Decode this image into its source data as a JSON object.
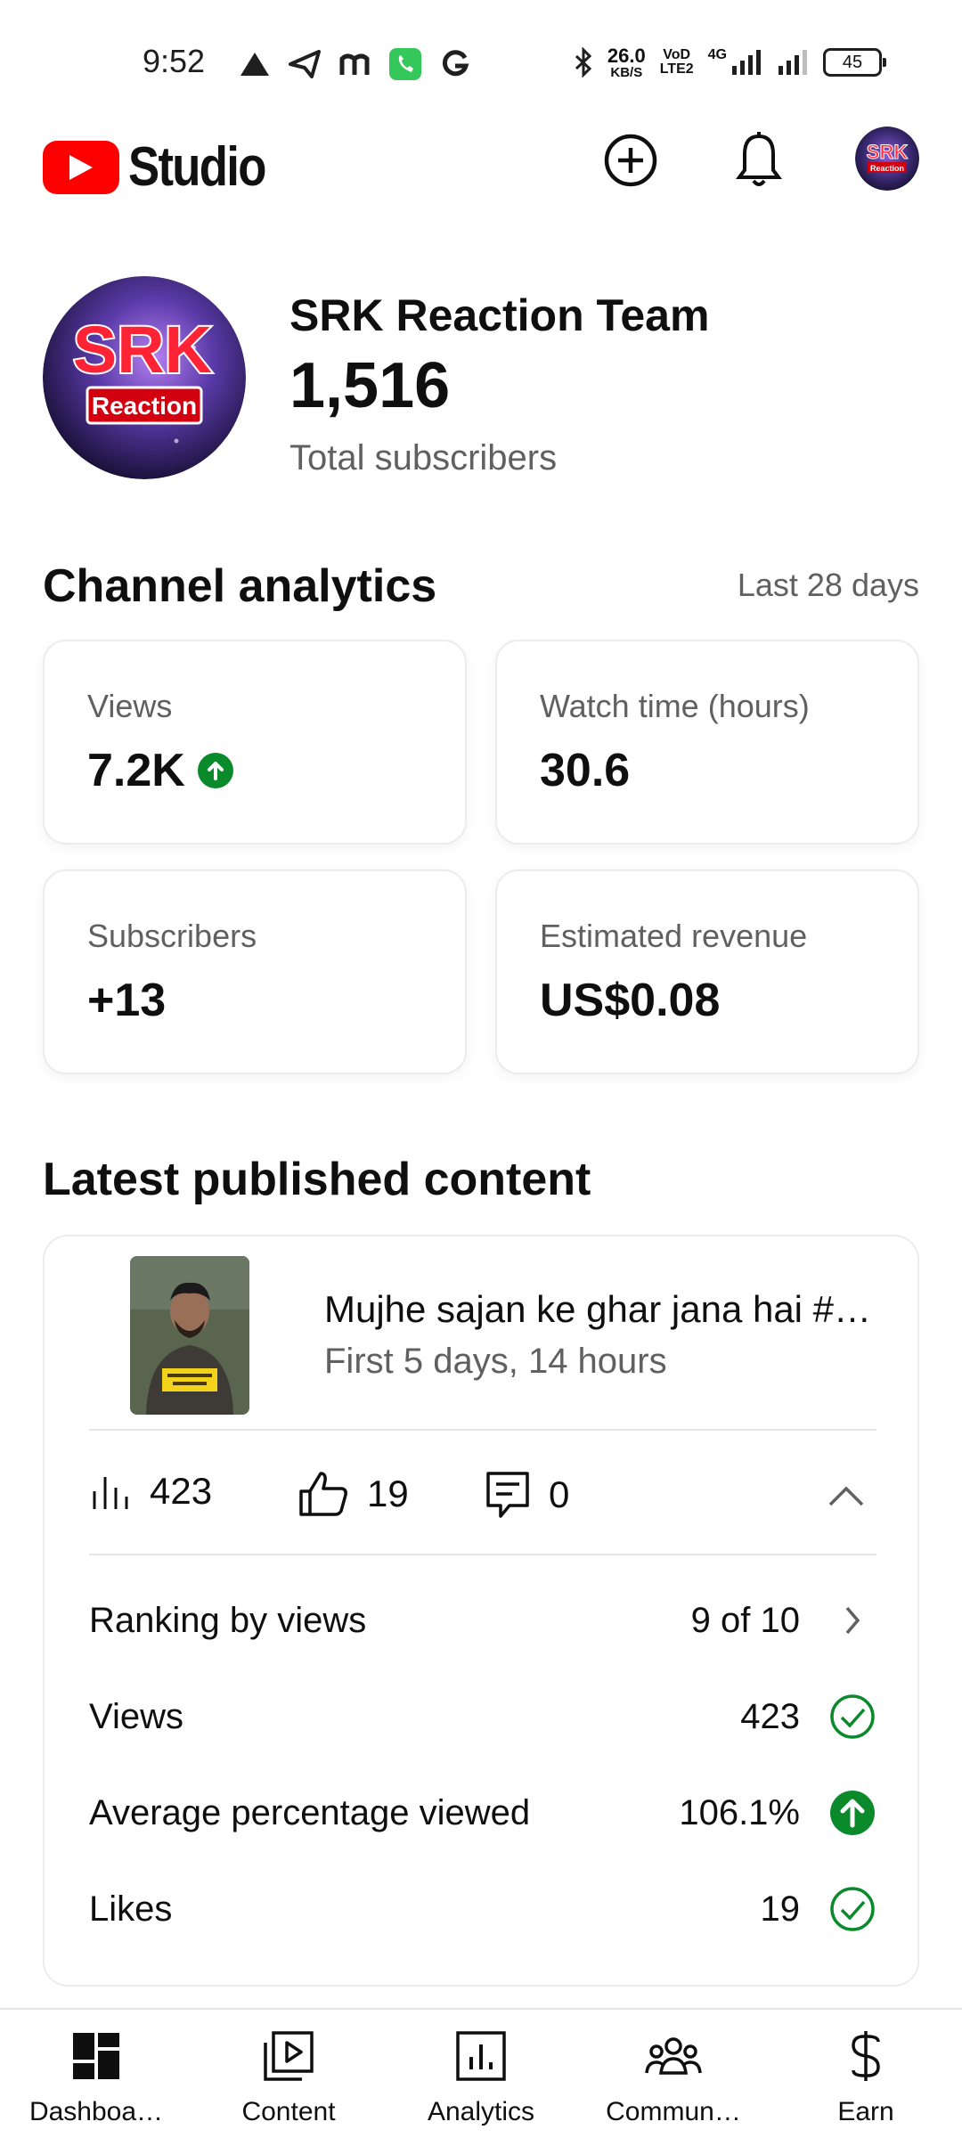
{
  "status_bar": {
    "time": "9:52",
    "left_icons": [
      "triangle-icon",
      "send-icon",
      "m-icon",
      "phone-icon",
      "g-icon"
    ],
    "net_speed_value": "26.0",
    "net_speed_unit": "KB/S",
    "volte_top": "VoD",
    "volte_bottom": "LTE2",
    "network": "4G",
    "battery": "45"
  },
  "app_bar": {
    "logo_text": "Studio",
    "create_icon": "plus-circle-icon",
    "notifications_icon": "bell-icon",
    "avatar_icon": "channel-avatar"
  },
  "channel": {
    "name": "SRK Reaction Team",
    "subscribers": "1,516",
    "subscribers_label": "Total subscribers",
    "avatar_top_text": "SRK",
    "avatar_bottom_text": "Reaction"
  },
  "analytics": {
    "title": "Channel analytics",
    "range": "Last 28 days",
    "cards": [
      {
        "label": "Views",
        "value": "7.2K",
        "trend": "up"
      },
      {
        "label": "Watch time (hours)",
        "value": "30.6"
      },
      {
        "label": "Subscribers",
        "value": "+13"
      },
      {
        "label": "Estimated revenue",
        "value": "US$0.08"
      }
    ]
  },
  "latest_content": {
    "title": "Latest published content",
    "video_title": "Mujhe sajan ke ghar jana hai #comedy",
    "video_age": "First 5 days, 14 hours",
    "stats": {
      "views": "423",
      "likes": "19",
      "comments": "0"
    },
    "metrics": [
      {
        "label": "Ranking by views",
        "value": "9 of 10",
        "icon": "chevron-right-icon"
      },
      {
        "label": "Views",
        "value": "423",
        "icon": "check-circle-icon"
      },
      {
        "label": "Average percentage viewed",
        "value": "106.1%",
        "icon": "arrow-up-circle-icon"
      },
      {
        "label": "Likes",
        "value": "19",
        "icon": "check-circle-icon"
      }
    ],
    "colors": {
      "positive": "#0a8a2a"
    }
  },
  "bottom_nav": {
    "items": [
      {
        "label": "Dashboa…",
        "icon": "dashboard-icon"
      },
      {
        "label": "Content",
        "icon": "content-icon"
      },
      {
        "label": "Analytics",
        "icon": "analytics-icon"
      },
      {
        "label": "Commun…",
        "icon": "community-icon"
      },
      {
        "label": "Earn",
        "icon": "dollar-icon"
      }
    ]
  }
}
